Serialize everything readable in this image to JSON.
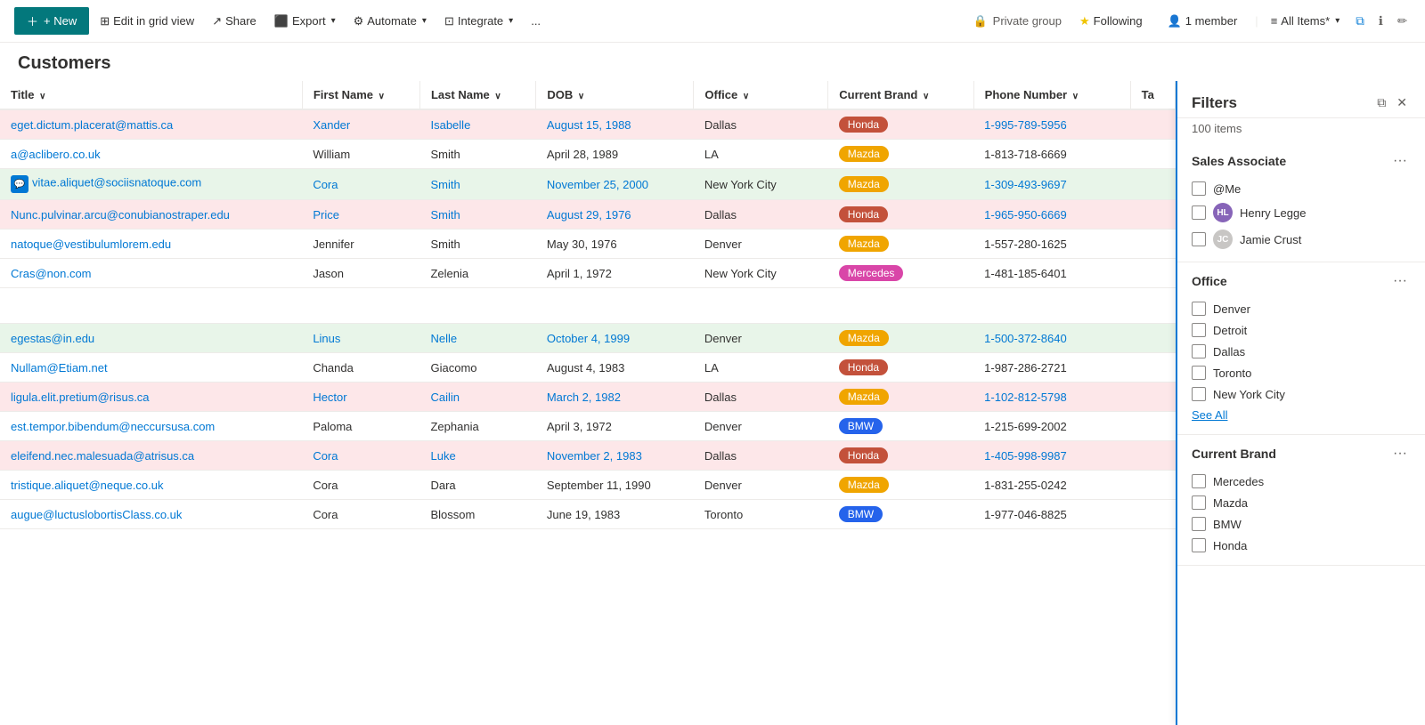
{
  "topbar": {
    "new_label": "+ New",
    "edit_grid_label": "Edit in grid view",
    "share_label": "Share",
    "export_label": "Export",
    "automate_label": "Automate",
    "integrate_label": "Integrate",
    "more_label": "...",
    "private_group_label": "Private group",
    "following_label": "Following",
    "members_label": "1 member",
    "all_items_label": "All Items*"
  },
  "page": {
    "title": "Customers"
  },
  "table": {
    "columns": [
      "Title",
      "First Name",
      "Last Name",
      "DOB",
      "Office",
      "Current Brand",
      "Phone Number",
      "Ta"
    ],
    "rows": [
      {
        "title": "eget.dictum.placerat@mattis.ca",
        "first_name": "Xander",
        "last_name": "Isabelle",
        "dob": "August 15, 1988",
        "office": "Dallas",
        "brand": "Honda",
        "phone": "1-995-789-5956",
        "row_style": "pink",
        "has_chat": false
      },
      {
        "title": "a@aclibero.co.uk",
        "first_name": "William",
        "last_name": "Smith",
        "dob": "April 28, 1989",
        "office": "LA",
        "brand": "Mazda",
        "phone": "1-813-718-6669",
        "row_style": "normal",
        "has_chat": false
      },
      {
        "title": "vitae.aliquet@sociisnatoque.com",
        "first_name": "Cora",
        "last_name": "Smith",
        "dob": "November 25, 2000",
        "office": "New York City",
        "brand": "Mazda",
        "phone": "1-309-493-9697",
        "row_style": "green",
        "has_chat": true
      },
      {
        "title": "Nunc.pulvinar.arcu@conubianostraper.edu",
        "first_name": "Price",
        "last_name": "Smith",
        "dob": "August 29, 1976",
        "office": "Dallas",
        "brand": "Honda",
        "phone": "1-965-950-6669",
        "row_style": "pink",
        "has_chat": false
      },
      {
        "title": "natoque@vestibulumlorem.edu",
        "first_name": "Jennifer",
        "last_name": "Smith",
        "dob": "May 30, 1976",
        "office": "Denver",
        "brand": "Mazda",
        "phone": "1-557-280-1625",
        "row_style": "normal",
        "has_chat": false
      },
      {
        "title": "Cras@non.com",
        "first_name": "Jason",
        "last_name": "Zelenia",
        "dob": "April 1, 1972",
        "office": "New York City",
        "brand": "Mercedes",
        "phone": "1-481-185-6401",
        "row_style": "normal",
        "has_chat": false
      },
      {
        "title": "",
        "first_name": "",
        "last_name": "",
        "dob": "",
        "office": "",
        "brand": "",
        "phone": "",
        "row_style": "normal",
        "has_chat": false,
        "spacer": true
      },
      {
        "title": "egestas@in.edu",
        "first_name": "Linus",
        "last_name": "Nelle",
        "dob": "October 4, 1999",
        "office": "Denver",
        "brand": "Mazda",
        "phone": "1-500-372-8640",
        "row_style": "green",
        "has_chat": false
      },
      {
        "title": "Nullam@Etiam.net",
        "first_name": "Chanda",
        "last_name": "Giacomo",
        "dob": "August 4, 1983",
        "office": "LA",
        "brand": "Honda",
        "phone": "1-987-286-2721",
        "row_style": "normal",
        "has_chat": false
      },
      {
        "title": "ligula.elit.pretium@risus.ca",
        "first_name": "Hector",
        "last_name": "Cailin",
        "dob": "March 2, 1982",
        "office": "Dallas",
        "brand": "Mazda",
        "phone": "1-102-812-5798",
        "row_style": "pink",
        "has_chat": false
      },
      {
        "title": "est.tempor.bibendum@neccursusa.com",
        "first_name": "Paloma",
        "last_name": "Zephania",
        "dob": "April 3, 1972",
        "office": "Denver",
        "brand": "BMW",
        "phone": "1-215-699-2002",
        "row_style": "normal",
        "has_chat": false
      },
      {
        "title": "eleifend.nec.malesuada@atrisus.ca",
        "first_name": "Cora",
        "last_name": "Luke",
        "dob": "November 2, 1983",
        "office": "Dallas",
        "brand": "Honda",
        "phone": "1-405-998-9987",
        "row_style": "pink",
        "has_chat": false
      },
      {
        "title": "tristique.aliquet@neque.co.uk",
        "first_name": "Cora",
        "last_name": "Dara",
        "dob": "September 11, 1990",
        "office": "Denver",
        "brand": "Mazda",
        "phone": "1-831-255-0242",
        "row_style": "normal",
        "has_chat": false
      },
      {
        "title": "augue@luctuslobortisClass.co.uk",
        "first_name": "Cora",
        "last_name": "Blossom",
        "dob": "June 19, 1983",
        "office": "Toronto",
        "brand": "BMW",
        "phone": "1-977-046-8825",
        "row_style": "normal",
        "has_chat": false
      }
    ]
  },
  "filters": {
    "title": "Filters",
    "count": "100 items",
    "sections": [
      {
        "id": "sales_associate",
        "title": "Sales Associate",
        "items": [
          {
            "label": "@Me",
            "type": "text",
            "checked": false
          },
          {
            "label": "Henry Legge",
            "type": "avatar",
            "avatar_initials": "HL",
            "checked": false
          },
          {
            "label": "Jamie Crust",
            "type": "avatar",
            "avatar_initials": "JC",
            "checked": false
          }
        ]
      },
      {
        "id": "office",
        "title": "Office",
        "items": [
          {
            "label": "Denver",
            "type": "text",
            "checked": false
          },
          {
            "label": "Detroit",
            "type": "text",
            "checked": false
          },
          {
            "label": "Dallas",
            "type": "text",
            "checked": false
          },
          {
            "label": "Toronto",
            "type": "text",
            "checked": false
          },
          {
            "label": "New York City",
            "type": "text",
            "checked": false
          }
        ],
        "see_all": true
      },
      {
        "id": "current_brand",
        "title": "Current Brand",
        "items": [
          {
            "label": "Mercedes",
            "type": "text",
            "checked": false
          },
          {
            "label": "Mazda",
            "type": "text",
            "checked": false
          },
          {
            "label": "BMW",
            "type": "text",
            "checked": false
          },
          {
            "label": "Honda",
            "type": "text",
            "checked": false
          }
        ]
      }
    ],
    "see_all_label": "See All"
  }
}
